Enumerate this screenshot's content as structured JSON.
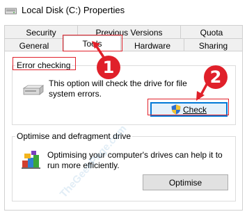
{
  "window": {
    "title": "Local Disk (C:) Properties"
  },
  "tabs": {
    "security": "Security",
    "previous_versions": "Previous Versions",
    "quota": "Quota",
    "general": "General",
    "tools": "Tools",
    "hardware": "Hardware",
    "sharing": "Sharing"
  },
  "error_checking": {
    "title": "Error checking",
    "description": "This option will check the drive for file system errors.",
    "button_label": "Check"
  },
  "optimise": {
    "title": "Optimise and defragment drive",
    "description": "Optimising your computer's drives can help it to run more efficiently.",
    "button_label": "Optimise"
  },
  "annotations": {
    "step1": "1",
    "step2": "2",
    "accent": "#e0202a"
  },
  "watermark": {
    "text": "TheGeekPage.com"
  }
}
